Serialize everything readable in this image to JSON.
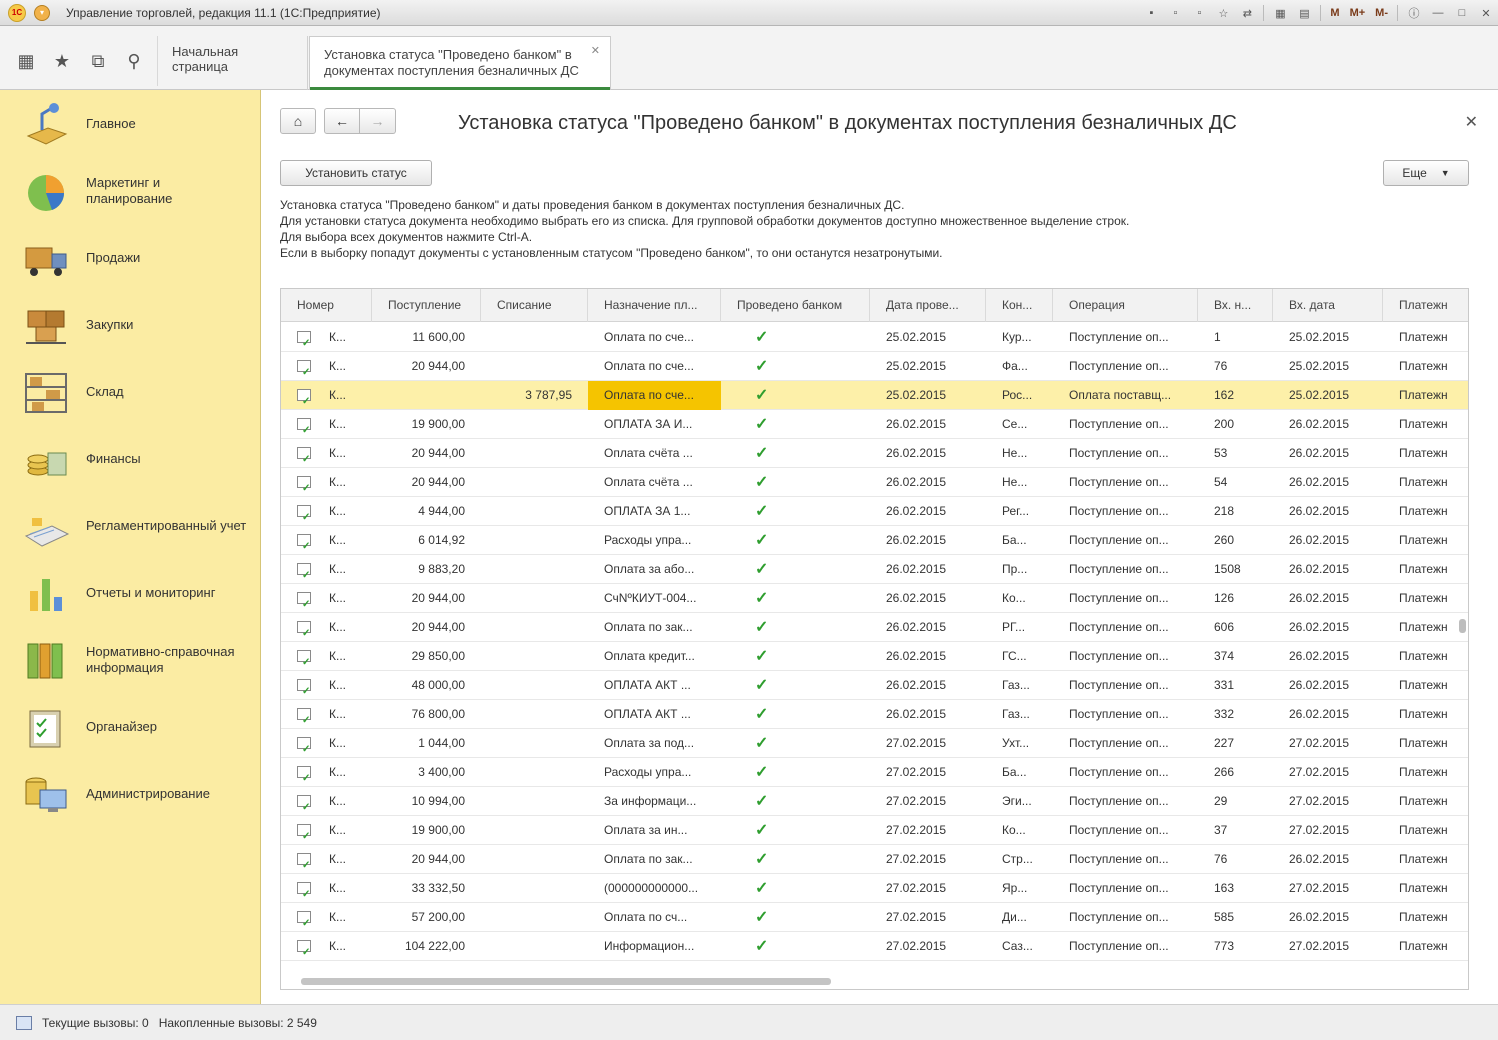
{
  "window": {
    "title": "Управление торговлей, редакция 11.1  (1С:Предприятие)",
    "logo_text": "1С",
    "tools": [
      "M",
      "M+",
      "M-"
    ]
  },
  "tabs": {
    "home": "Начальная страница",
    "active": "Установка статуса \"Проведено банком\" в документах поступления безналичных ДС"
  },
  "sidebar": {
    "items": [
      {
        "label": "Главное",
        "icon": "desk-lamp-icon"
      },
      {
        "label": "Маркетинг и планирование",
        "icon": "pie-chart-icon"
      },
      {
        "label": "Продажи",
        "icon": "delivery-truck-icon"
      },
      {
        "label": "Закупки",
        "icon": "boxes-cart-icon"
      },
      {
        "label": "Склад",
        "icon": "warehouse-shelves-icon"
      },
      {
        "label": "Финансы",
        "icon": "coins-icon"
      },
      {
        "label": "Регламентированный учет",
        "icon": "ledger-icon"
      },
      {
        "label": "Отчеты и мониторинг",
        "icon": "bar-chart-icon"
      },
      {
        "label": "Нормативно-справочная информация",
        "icon": "binders-icon"
      },
      {
        "label": "Органайзер",
        "icon": "clipboard-icon"
      },
      {
        "label": "Администрирование",
        "icon": "computer-database-icon"
      }
    ]
  },
  "form": {
    "title": "Установка статуса \"Проведено банком\" в документах поступления безналичных ДС",
    "set_status_button": "Установить статус",
    "more_button": "Еще",
    "description": [
      "Установка статуса \"Проведено банком\" и даты проведения банком в документах поступления безналичных ДС.",
      "Для установки статуса документа необходимо выбрать его из списка. Для групповой обработки документов доступно множественное выделение строк.",
      "Для выбора всех документов нажмите Ctrl-A.",
      "Если в выборку попадут документы с установленным статусом \"Проведено банком\", то они останутся незатронутыми."
    ]
  },
  "grid": {
    "columns": [
      "Номер",
      "Поступление",
      "Списание",
      "Назначение пл...",
      "Проведено банком",
      "Дата прове...",
      "Кон...",
      "Операция",
      "Вх. н...",
      "Вх. дата",
      "Платежн"
    ],
    "rows": [
      {
        "num": "К...",
        "in": "11 600,00",
        "out": "",
        "purpose": "Оплата по сче...",
        "date": "25.02.2015",
        "ctr": "Кур...",
        "op": "Поступление оп...",
        "inno": "1",
        "indate": "25.02.2015",
        "pay": "Платежн"
      },
      {
        "num": "К...",
        "in": "20 944,00",
        "out": "",
        "purpose": "Оплата по сче...",
        "date": "25.02.2015",
        "ctr": "Фа...",
        "op": "Поступление оп...",
        "inno": "76",
        "indate": "25.02.2015",
        "pay": "Платежн"
      },
      {
        "num": "К...",
        "in": "",
        "out": "3 787,95",
        "purpose": "Оплата по сче...",
        "date": "25.02.2015",
        "ctr": "Рос...",
        "op": "Оплата поставщ...",
        "inno": "162",
        "indate": "25.02.2015",
        "pay": "Платежн",
        "selected": true
      },
      {
        "num": "К...",
        "in": "19 900,00",
        "out": "",
        "purpose": "ОПЛАТА ЗА И...",
        "date": "26.02.2015",
        "ctr": "Се...",
        "op": "Поступление оп...",
        "inno": "200",
        "indate": "26.02.2015",
        "pay": "Платежн"
      },
      {
        "num": "К...",
        "in": "20 944,00",
        "out": "",
        "purpose": "Оплата  счёта ...",
        "date": "26.02.2015",
        "ctr": "Не...",
        "op": "Поступление оп...",
        "inno": "53",
        "indate": "26.02.2015",
        "pay": "Платежн"
      },
      {
        "num": "К...",
        "in": "20 944,00",
        "out": "",
        "purpose": "Оплата  счёта ...",
        "date": "26.02.2015",
        "ctr": "Не...",
        "op": "Поступление оп...",
        "inno": "54",
        "indate": "26.02.2015",
        "pay": "Платежн"
      },
      {
        "num": "К...",
        "in": "4 944,00",
        "out": "",
        "purpose": "ОПЛАТА ЗА 1...",
        "date": "26.02.2015",
        "ctr": "Рег...",
        "op": "Поступление оп...",
        "inno": "218",
        "indate": "26.02.2015",
        "pay": "Платежн"
      },
      {
        "num": "К...",
        "in": "6 014,92",
        "out": "",
        "purpose": "Расходы упра...",
        "date": "26.02.2015",
        "ctr": "Ба...",
        "op": "Поступление оп...",
        "inno": "260",
        "indate": "26.02.2015",
        "pay": "Платежн"
      },
      {
        "num": "К...",
        "in": "9 883,20",
        "out": "",
        "purpose": "Оплата за або...",
        "date": "26.02.2015",
        "ctr": "Пр...",
        "op": "Поступление оп...",
        "inno": "1508",
        "indate": "26.02.2015",
        "pay": "Платежн"
      },
      {
        "num": "К...",
        "in": "20 944,00",
        "out": "",
        "purpose": "СчNºКИУТ-004...",
        "date": "26.02.2015",
        "ctr": "Ко...",
        "op": "Поступление оп...",
        "inno": "126",
        "indate": "26.02.2015",
        "pay": "Платежн"
      },
      {
        "num": "К...",
        "in": "20 944,00",
        "out": "",
        "purpose": "Оплата по зак...",
        "date": "26.02.2015",
        "ctr": "РГ...",
        "op": "Поступление оп...",
        "inno": "606",
        "indate": "26.02.2015",
        "pay": "Платежн"
      },
      {
        "num": "К...",
        "in": "29 850,00",
        "out": "",
        "purpose": "Оплата кредит...",
        "date": "26.02.2015",
        "ctr": "ГС...",
        "op": "Поступление оп...",
        "inno": "374",
        "indate": "26.02.2015",
        "pay": "Платежн"
      },
      {
        "num": "К...",
        "in": "48 000,00",
        "out": "",
        "purpose": "ОПЛАТА АКТ ...",
        "date": "26.02.2015",
        "ctr": "Газ...",
        "op": "Поступление оп...",
        "inno": "331",
        "indate": "26.02.2015",
        "pay": "Платежн"
      },
      {
        "num": "К...",
        "in": "76 800,00",
        "out": "",
        "purpose": "ОПЛАТА АКТ ...",
        "date": "26.02.2015",
        "ctr": "Газ...",
        "op": "Поступление оп...",
        "inno": "332",
        "indate": "26.02.2015",
        "pay": "Платежн"
      },
      {
        "num": "К...",
        "in": "1 044,00",
        "out": "",
        "purpose": "Оплата за под...",
        "date": "27.02.2015",
        "ctr": "Ухт...",
        "op": "Поступление оп...",
        "inno": "227",
        "indate": "27.02.2015",
        "pay": "Платежн"
      },
      {
        "num": "К...",
        "in": "3 400,00",
        "out": "",
        "purpose": "Расходы упра...",
        "date": "27.02.2015",
        "ctr": "Ба...",
        "op": "Поступление оп...",
        "inno": "266",
        "indate": "27.02.2015",
        "pay": "Платежн"
      },
      {
        "num": "К...",
        "in": "10 994,00",
        "out": "",
        "purpose": "За информаци...",
        "date": "27.02.2015",
        "ctr": "Эги...",
        "op": "Поступление оп...",
        "inno": "29",
        "indate": "27.02.2015",
        "pay": "Платежн"
      },
      {
        "num": "К...",
        "in": "19 900,00",
        "out": "",
        "purpose": "Оплата  за  ин...",
        "date": "27.02.2015",
        "ctr": "Ко...",
        "op": "Поступление оп...",
        "inno": "37",
        "indate": "27.02.2015",
        "pay": "Платежн"
      },
      {
        "num": "К...",
        "in": "20 944,00",
        "out": "",
        "purpose": "Оплата по зак...",
        "date": "27.02.2015",
        "ctr": "Стр...",
        "op": "Поступление оп...",
        "inno": "76",
        "indate": "26.02.2015",
        "pay": "Платежн"
      },
      {
        "num": "К...",
        "in": "33 332,50",
        "out": "",
        "purpose": "(000000000000...",
        "date": "27.02.2015",
        "ctr": "Яр...",
        "op": "Поступление оп...",
        "inno": "163",
        "indate": "27.02.2015",
        "pay": "Платежн"
      },
      {
        "num": "К...",
        "in": "57 200,00",
        "out": "",
        "purpose": "Оплата по сч...",
        "date": "27.02.2015",
        "ctr": "Ди...",
        "op": "Поступление оп...",
        "inno": "585",
        "indate": "26.02.2015",
        "pay": "Платежн"
      },
      {
        "num": "К...",
        "in": "104 222,00",
        "out": "",
        "purpose": "Информацион...",
        "date": "27.02.2015",
        "ctr": "Саз...",
        "op": "Поступление оп...",
        "inno": "773",
        "indate": "27.02.2015",
        "pay": "Платежн"
      }
    ]
  },
  "statusbar": {
    "current_calls": "Текущие вызовы: 0",
    "accumulated_calls": "Накопленные вызовы: 2 549"
  }
}
